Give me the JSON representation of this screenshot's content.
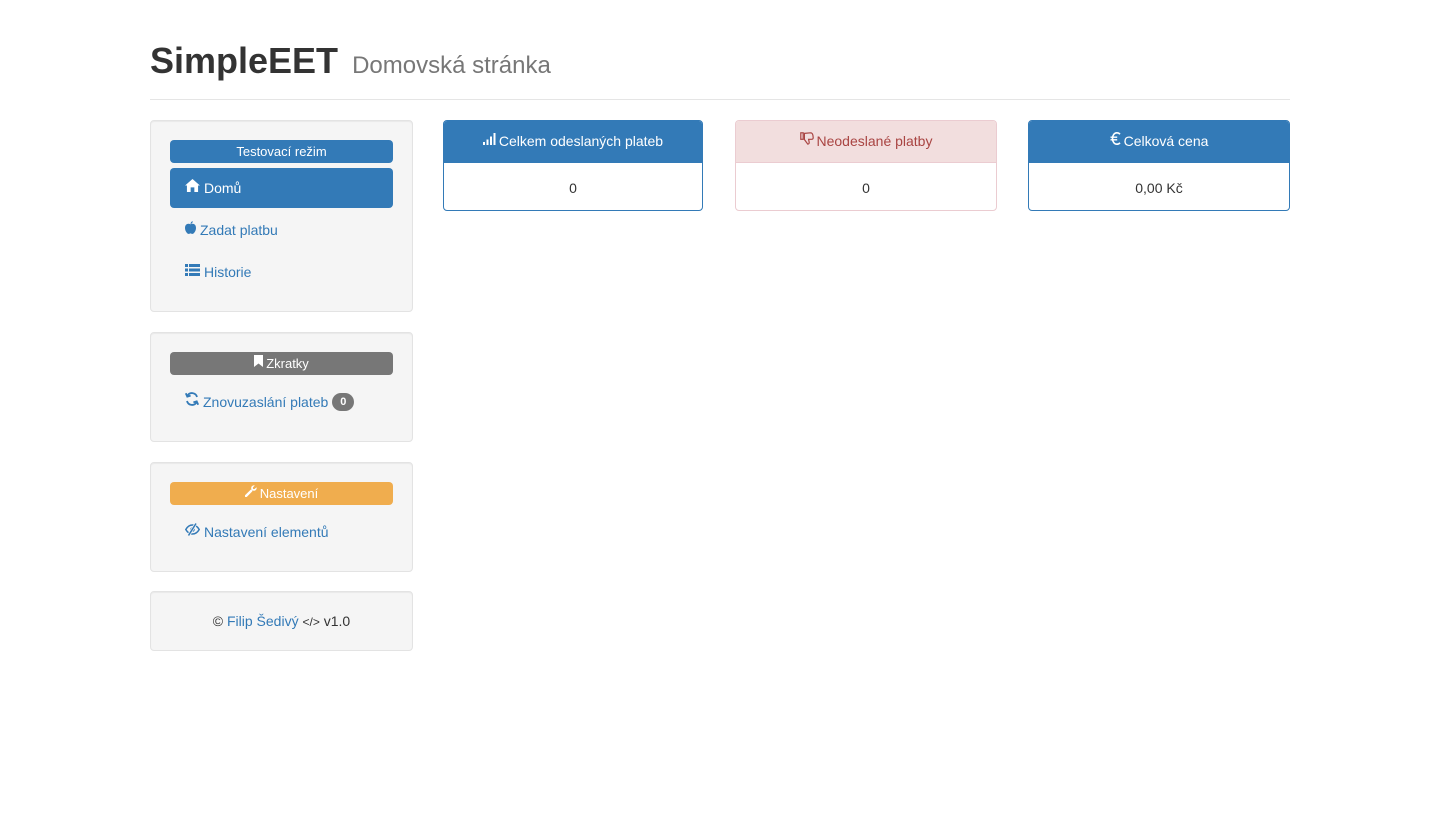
{
  "header": {
    "title": "SimpleEET",
    "subtitle": "Domovská stránka"
  },
  "sidebar": {
    "mode_label": "Testovací režim",
    "nav": [
      {
        "label": "Domů",
        "icon": "home-icon",
        "active": true
      },
      {
        "label": "Zadat platbu",
        "icon": "apple-icon",
        "active": false
      },
      {
        "label": "Historie",
        "icon": "list-icon",
        "active": false
      }
    ],
    "shortcuts": {
      "label": "Zkratky",
      "icon": "bookmark-icon",
      "items": [
        {
          "label": "Znovuzaslání plateb",
          "icon": "refresh-icon",
          "badge": "0"
        }
      ]
    },
    "settings": {
      "label": "Nastavení",
      "icon": "wrench-icon",
      "items": [
        {
          "label": "Nastavení elementů",
          "icon": "eye-slash-icon"
        }
      ]
    },
    "footer": {
      "copyright": "©",
      "author": "Filip Šedivý",
      "code_symbol": "</>",
      "version": "v1.0"
    }
  },
  "stats": [
    {
      "title": "Celkem odeslaných plateb",
      "value": "0",
      "icon": "signal-icon",
      "style": "primary"
    },
    {
      "title": "Neodeslané platby",
      "value": "0",
      "icon": "thumbs-down-icon",
      "style": "danger"
    },
    {
      "title": "Celková cena",
      "value": "0,00 Kč",
      "icon": "euro-icon",
      "style": "primary"
    }
  ],
  "colors": {
    "primary": "#337ab7",
    "mode_label_bg": "#337ab7",
    "shortcuts_label_bg": "#777777",
    "settings_label_bg": "#f0ad4e",
    "danger_bg": "#f2dede",
    "danger_text": "#a94442"
  }
}
